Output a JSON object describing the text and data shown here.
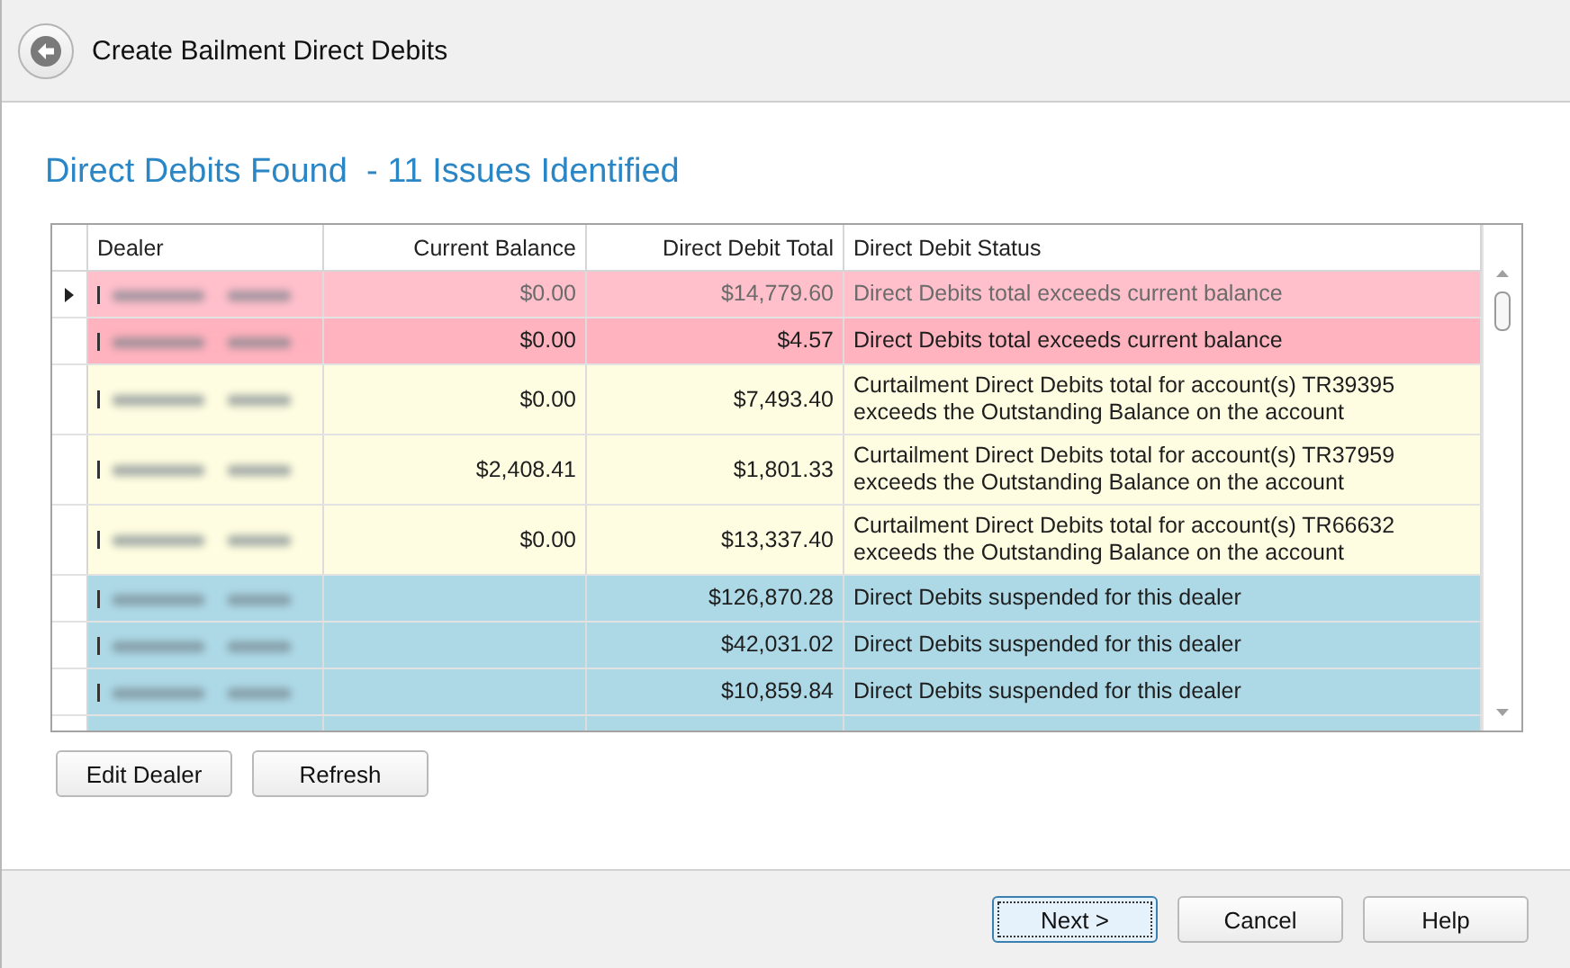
{
  "header": {
    "title": "Create Bailment Direct Debits"
  },
  "heading": "Direct Debits Found  - 11 Issues Identified",
  "table": {
    "columns": [
      "Dealer",
      "Current Balance",
      "Direct Debit Total",
      "Direct Debit Status"
    ],
    "rows": [
      {
        "selected": true,
        "color": "#ffc0cb",
        "current_balance": "$0.00",
        "direct_debit_total": "$14,779.60",
        "status": "Direct Debits total exceeds current balance"
      },
      {
        "selected": false,
        "color": "#ffb3be",
        "current_balance": "$0.00",
        "direct_debit_total": "$4.57",
        "status": "Direct Debits total exceeds current balance"
      },
      {
        "selected": false,
        "color": "#fffde1",
        "current_balance": "$0.00",
        "direct_debit_total": "$7,493.40",
        "status": "Curtailment Direct Debits total for account(s) TR39395 exceeds the Outstanding Balance on the account"
      },
      {
        "selected": false,
        "color": "#fffde1",
        "current_balance": "$2,408.41",
        "direct_debit_total": "$1,801.33",
        "status": "Curtailment Direct Debits total for account(s) TR37959 exceeds the Outstanding Balance on the account"
      },
      {
        "selected": false,
        "color": "#fffde1",
        "current_balance": "$0.00",
        "direct_debit_total": "$13,337.40",
        "status": "Curtailment Direct Debits total for account(s) TR66632 exceeds the Outstanding Balance on the account"
      },
      {
        "selected": false,
        "color": "#add8e6",
        "direct_debit_total": "$126,870.28",
        "status": "Direct Debits suspended for this dealer"
      },
      {
        "selected": false,
        "color": "#add8e6",
        "direct_debit_total": "$42,031.02",
        "status": "Direct Debits suspended for this dealer"
      },
      {
        "selected": false,
        "color": "#add8e6",
        "direct_debit_total": "$10,859.84",
        "status": "Direct Debits suspended for this dealer"
      },
      {
        "color": "#add8e6"
      }
    ]
  },
  "actions": [
    "Edit Dealer",
    "Refresh"
  ],
  "footer": {
    "buttons": [
      {
        "label": "Next >",
        "default": true
      },
      {
        "label": "Cancel",
        "default": false
      },
      {
        "label": "Help",
        "default": false
      }
    ]
  }
}
